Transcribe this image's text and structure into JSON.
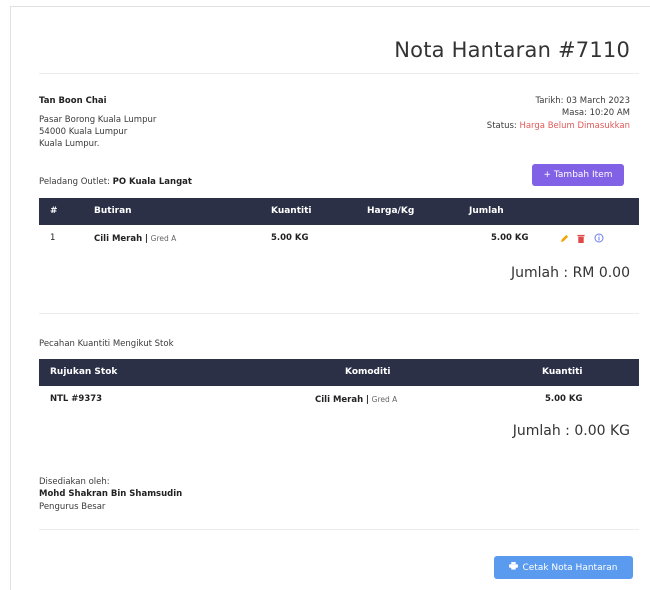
{
  "header": {
    "title": "Nota Hantaran #7110"
  },
  "customer": {
    "name": "Tan Boon Chai",
    "address_line1": "Pasar Borong Kuala Lumpur",
    "address_line2": "54000 Kuala Lumpur",
    "address_line3": "Kuala Lumpur."
  },
  "meta": {
    "date_label": "Tarikh: 03 March 2023",
    "time_label": "Masa: 10:20 AM",
    "status_label": "Status:",
    "status_value": "Harga Belum Dimasukkan"
  },
  "outlet": {
    "label": "Peladang Outlet:",
    "value": "PO Kuala Langat"
  },
  "buttons": {
    "add_item": "+ Tambah Item",
    "print": "Cetak Nota Hantaran"
  },
  "items_table": {
    "headers": [
      "#",
      "Butiran",
      "Kuantiti",
      "Harga/Kg",
      "Jumlah"
    ],
    "rows": [
      {
        "no": "1",
        "item": "Cili Merah",
        "sep": "|",
        "grade": "Gred A",
        "qty": "5.00 KG",
        "price": "",
        "total": "5.00 KG"
      }
    ],
    "grand_total": "Jumlah : RM 0.00"
  },
  "stock": {
    "title": "Pecahan Kuantiti Mengikut Stok",
    "headers": [
      "Rujukan Stok",
      "Komoditi",
      "Kuantiti"
    ],
    "rows": [
      {
        "ref": "NTL #9373",
        "commodity": "Cili Merah",
        "sep": "|",
        "grade": "Gred A",
        "qty": "5.00 KG"
      }
    ],
    "grand_total": "Jumlah : 0.00 KG"
  },
  "prepared": {
    "label": "Disediakan oleh:",
    "name": "Mohd Shakran Bin Shamsudin",
    "role": "Pengurus Besar"
  },
  "colors": {
    "accent_purple": "#8161e6",
    "accent_blue": "#5b9bef",
    "table_head": "#2b3046",
    "status_red": "#e05a5a"
  }
}
